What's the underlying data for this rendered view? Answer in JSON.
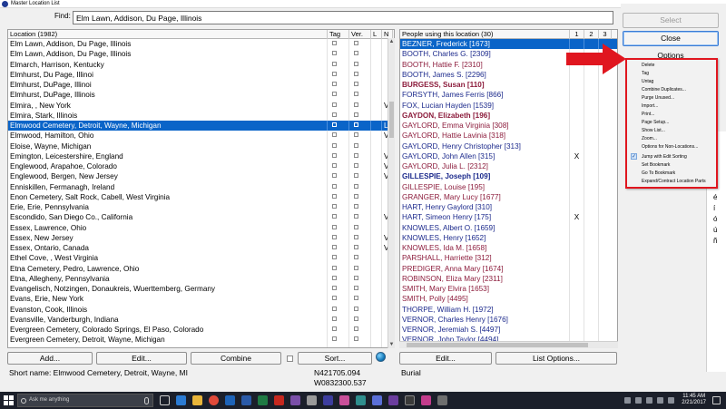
{
  "window": {
    "title": "Master Location List"
  },
  "find": {
    "label": "Find:",
    "value": "Elm Lawn, Addison, Du Page, Illinois"
  },
  "locations": {
    "headers": {
      "location": "Location (1982)",
      "tag": "Tag",
      "ver": "Ver.",
      "l": "L",
      "n": "N"
    },
    "rows": [
      {
        "name": "Elm Lawn, Addison, Du Page, Illinois",
        "v": "",
        "l": ""
      },
      {
        "name": "Elm Lawn, Addison, Du Page, Illinois",
        "v": "",
        "l": ""
      },
      {
        "name": "Elmarch, Harrison, Kentucky",
        "v": "",
        "l": ""
      },
      {
        "name": "Elmhurst, Du Page, Illinoi",
        "v": "",
        "l": ""
      },
      {
        "name": "Elmhurst, DuPage, Illinoi",
        "v": "",
        "l": ""
      },
      {
        "name": "Elmhurst, DuPage, Illinois",
        "v": "",
        "l": ""
      },
      {
        "name": "Elmira, , New York",
        "v": "",
        "l": "V"
      },
      {
        "name": "Elmira, Stark, Illinois",
        "v": "",
        "l": ""
      },
      {
        "name": "Elmwood Cemetery, Detroit, Wayne, Michigan",
        "v": "",
        "l": "L",
        "selected": true
      },
      {
        "name": "Elmwood, Hamilton, Ohio",
        "v": "",
        "l": "V"
      },
      {
        "name": "Eloise, Wayne, Michigan",
        "v": "",
        "l": ""
      },
      {
        "name": "Emington, Leicestershire, England",
        "v": "",
        "l": "V"
      },
      {
        "name": "Englewood, Arapahoe, Colorado",
        "v": "",
        "l": "V"
      },
      {
        "name": "Englewood, Bergen, New Jersey",
        "v": "",
        "l": "V"
      },
      {
        "name": "Enniskillen, Fermanagh, Ireland",
        "v": "",
        "l": ""
      },
      {
        "name": "Enon Cemetery, Salt Rock, Cabell, West Virginia",
        "v": "",
        "l": ""
      },
      {
        "name": "Erie, Erie, Pennsylvania",
        "v": "",
        "l": ""
      },
      {
        "name": "Escondido, San Diego Co., California",
        "v": "",
        "l": "V"
      },
      {
        "name": "Essex, Lawrence, Ohio",
        "v": "",
        "l": ""
      },
      {
        "name": "Essex, New Jersey",
        "v": "",
        "l": "V"
      },
      {
        "name": "Essex, Ontario, Canada",
        "v": "",
        "l": "V"
      },
      {
        "name": "Ethel Cove, , West Virginia",
        "v": "",
        "l": ""
      },
      {
        "name": "Etna Cemetery, Pedro, Lawrence, Ohio",
        "v": "",
        "l": ""
      },
      {
        "name": "Etna, Allegheny, Pennsylvania",
        "v": "",
        "l": ""
      },
      {
        "name": "Evangelisch, Notzingen, Donaukreis, Wuerttemberg, Germany",
        "v": "",
        "l": ""
      },
      {
        "name": "Evans, Erie, New York",
        "v": "",
        "l": ""
      },
      {
        "name": "Evanston, Cook, Illinois",
        "v": "",
        "l": ""
      },
      {
        "name": "Evansville, Vanderburgh, Indiana",
        "v": "",
        "l": ""
      },
      {
        "name": "Evergreen Cemetery, Colorado Springs, El Paso, Colorado",
        "v": "",
        "l": ""
      },
      {
        "name": "Evergreen Cemetery, Detroit, Wayne, Michigan",
        "v": "",
        "l": ""
      },
      {
        "name": "Evergreen Cemetery, Detroit, Wayne, Michigan",
        "v": "",
        "l": ""
      }
    ]
  },
  "people": {
    "headers": {
      "name": "People using this location (30)",
      "c1": "1",
      "c2": "2",
      "c3": "3"
    },
    "rows": [
      {
        "name": "BEZNER, Frederick [1673]",
        "sex": "male",
        "bold": false,
        "c1": "",
        "c2": "",
        "selected": true
      },
      {
        "name": "BOOTH, Charles G. [2309]",
        "sex": "male",
        "bold": false,
        "c1": "",
        "c2": ""
      },
      {
        "name": "BOOTH, Hattie F. [2310]",
        "sex": "female",
        "bold": false,
        "c1": "",
        "c2": ""
      },
      {
        "name": "BOOTH, James S. [2296]",
        "sex": "male",
        "bold": false,
        "c1": "",
        "c2": ""
      },
      {
        "name": "BURGESS, Susan [110]",
        "sex": "female",
        "bold": true,
        "c1": "",
        "c2": ""
      },
      {
        "name": "FORSYTH, James Ferris [866]",
        "sex": "male",
        "bold": false,
        "c1": "",
        "c2": ""
      },
      {
        "name": "FOX, Lucian Hayden [1539]",
        "sex": "male",
        "bold": false,
        "c1": "",
        "c2": ""
      },
      {
        "name": "GAYDON, Elizabeth [196]",
        "sex": "female",
        "bold": true,
        "c1": "",
        "c2": ""
      },
      {
        "name": "GAYLORD, Emma Virginia [308]",
        "sex": "female",
        "bold": false,
        "c1": "",
        "c2": ""
      },
      {
        "name": "GAYLORD, Hattie Lavinia [318]",
        "sex": "female",
        "bold": false,
        "c1": "",
        "c2": ""
      },
      {
        "name": "GAYLORD, Henry Christopher [313]",
        "sex": "male",
        "bold": false,
        "c1": "",
        "c2": ""
      },
      {
        "name": "GAYLORD, John Allen [315]",
        "sex": "male",
        "bold": false,
        "c1": "X",
        "c2": ""
      },
      {
        "name": "GAYLORD, Julia L. [2312]",
        "sex": "female",
        "bold": false,
        "c1": "",
        "c2": ""
      },
      {
        "name": "GILLESPIE, Joseph [109]",
        "sex": "male",
        "bold": true,
        "c1": "",
        "c2": ""
      },
      {
        "name": "GILLESPIE, Louise [195]",
        "sex": "female",
        "bold": false,
        "c1": "",
        "c2": ""
      },
      {
        "name": "GRANGER, Mary Lucy [1677]",
        "sex": "female",
        "bold": false,
        "c1": "",
        "c2": ""
      },
      {
        "name": "HART, Henry Gaylord [310]",
        "sex": "male",
        "bold": false,
        "c1": "",
        "c2": ""
      },
      {
        "name": "HART, Simeon Henry [175]",
        "sex": "male",
        "bold": false,
        "c1": "X",
        "c2": ""
      },
      {
        "name": "KNOWLES, Albert O. [1659]",
        "sex": "male",
        "bold": false,
        "c1": "",
        "c2": ""
      },
      {
        "name": "KNOWLES, Henry [1652]",
        "sex": "male",
        "bold": false,
        "c1": "",
        "c2": ""
      },
      {
        "name": "KNOWLES, Ida M. [1658]",
        "sex": "female",
        "bold": false,
        "c1": "",
        "c2": ""
      },
      {
        "name": "PARSHALL, Harriette [312]",
        "sex": "female",
        "bold": false,
        "c1": "",
        "c2": ""
      },
      {
        "name": "PREDIGER, Anna Mary [1674]",
        "sex": "female",
        "bold": false,
        "c1": "",
        "c2": ""
      },
      {
        "name": "ROBINSON, Eliza Mary [2311]",
        "sex": "female",
        "bold": false,
        "c1": "",
        "c2": ""
      },
      {
        "name": "SMITH, Mary Elvira [1653]",
        "sex": "female",
        "bold": false,
        "c1": "",
        "c2": ""
      },
      {
        "name": "SMITH, Polly [4495]",
        "sex": "female",
        "bold": false,
        "c1": "",
        "c2": ""
      },
      {
        "name": "THORPE, William H. [1972]",
        "sex": "male",
        "bold": false,
        "c1": "",
        "c2": ""
      },
      {
        "name": "VERNOR, Charles Henry [1676]",
        "sex": "male",
        "bold": false,
        "c1": "",
        "c2": ""
      },
      {
        "name": "VERNOR, Jeremiah S. [4497]",
        "sex": "male",
        "bold": false,
        "c1": "",
        "c2": ""
      },
      {
        "name": "VERNOR, John Taylor [4494]",
        "sex": "male",
        "bold": false,
        "c1": "",
        "c2": ""
      }
    ]
  },
  "buttons": {
    "add": "Add...",
    "edit": "Edit...",
    "combine": "Combine",
    "sort": "Sort...",
    "people_edit": "Edit...",
    "list_options": "List Options...",
    "select": "Select",
    "close": "Close",
    "options": "Options"
  },
  "status": {
    "short_name": "Short name: Elmwood Cemetery, Detroit, Wayne, MI",
    "lat": "N421705.094",
    "lon": "W0832300.537",
    "event": "Burial"
  },
  "options_menu": [
    "Delete",
    "Tag",
    "Untag",
    "Combine Duplicates...",
    "Purge Unused...",
    "Import...",
    "Print...",
    "Page Setup...",
    "Show List...",
    "Zoom...",
    "Options for Non-Locations...",
    "Jump with Edit Sorting",
    "Set Bookmark",
    "Go To Bookmark",
    "Expand/Contract Location Parts"
  ],
  "side_chars": [
    "é",
    "í",
    "ó",
    "ú",
    "ñ"
  ],
  "taskbar": {
    "search_placeholder": "Ask me anything",
    "time": "11:45 AM",
    "date": "2/21/2017"
  },
  "colors": {
    "selection": "#0a64c8",
    "male": "#1c2a8c",
    "female": "#8c1c3c",
    "highlight": "#e0161f"
  }
}
